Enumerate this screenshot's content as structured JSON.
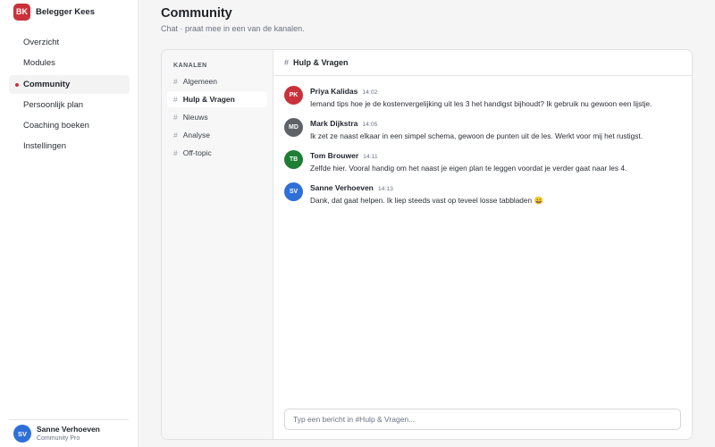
{
  "brand": {
    "initials": "BK",
    "name": "Belegger Kees"
  },
  "nav": [
    {
      "label": "Overzicht",
      "active": false
    },
    {
      "label": "Modules",
      "active": false
    },
    {
      "label": "Community",
      "active": true
    },
    {
      "label": "Persoonlijk plan",
      "active": false
    },
    {
      "label": "Coaching boeken",
      "active": false
    },
    {
      "label": "Instellingen",
      "active": false
    }
  ],
  "user": {
    "initials": "SV",
    "name": "Sanne Verhoeven",
    "plan": "Community Pro"
  },
  "page": {
    "title": "Community",
    "subtitle": "Chat · praat mee in een van de kanalen."
  },
  "channels": {
    "heading": "KANALEN",
    "hash": "#",
    "items": [
      {
        "label": "Algemeen",
        "active": false
      },
      {
        "label": "Hulp & Vragen",
        "active": true
      },
      {
        "label": "Nieuws",
        "active": false
      },
      {
        "label": "Analyse",
        "active": false
      },
      {
        "label": "Off-topic",
        "active": false
      }
    ]
  },
  "chat": {
    "hash": "#",
    "title": "Hulp & Vragen",
    "messages": [
      {
        "initials": "PK",
        "color": "#c9323a",
        "author": "Priya Kalidas",
        "time": "14:02",
        "text": "Iemand tips hoe je de kostenvergelijking uit les 3 het handigst bijhoudt? Ik gebruik nu gewoon een lijstje."
      },
      {
        "initials": "MD",
        "color": "#5f6368",
        "author": "Mark Dijkstra",
        "time": "14:05",
        "text": "Ik zet ze naast elkaar in een simpel schema, gewoon de punten uit de les. Werkt voor mij het rustigst."
      },
      {
        "initials": "TB",
        "color": "#1e7e34",
        "author": "Tom Brouwer",
        "time": "14:11",
        "text": "Zelfde hier. Vooral handig om het naast je eigen plan te leggen voordat je verder gaat naar les 4."
      },
      {
        "initials": "SV",
        "color": "#2f6fd8",
        "author": "Sanne Verhoeven",
        "time": "14:13",
        "text": "Dank, dat gaat helpen. Ik liep steeds vast op teveel losse tabbladen 😀"
      }
    ],
    "composer_placeholder": "Typ een bericht in #Hulp & Vragen..."
  },
  "colors": {
    "accent": "#c9323a",
    "user_avatar": "#2f6fd8"
  }
}
